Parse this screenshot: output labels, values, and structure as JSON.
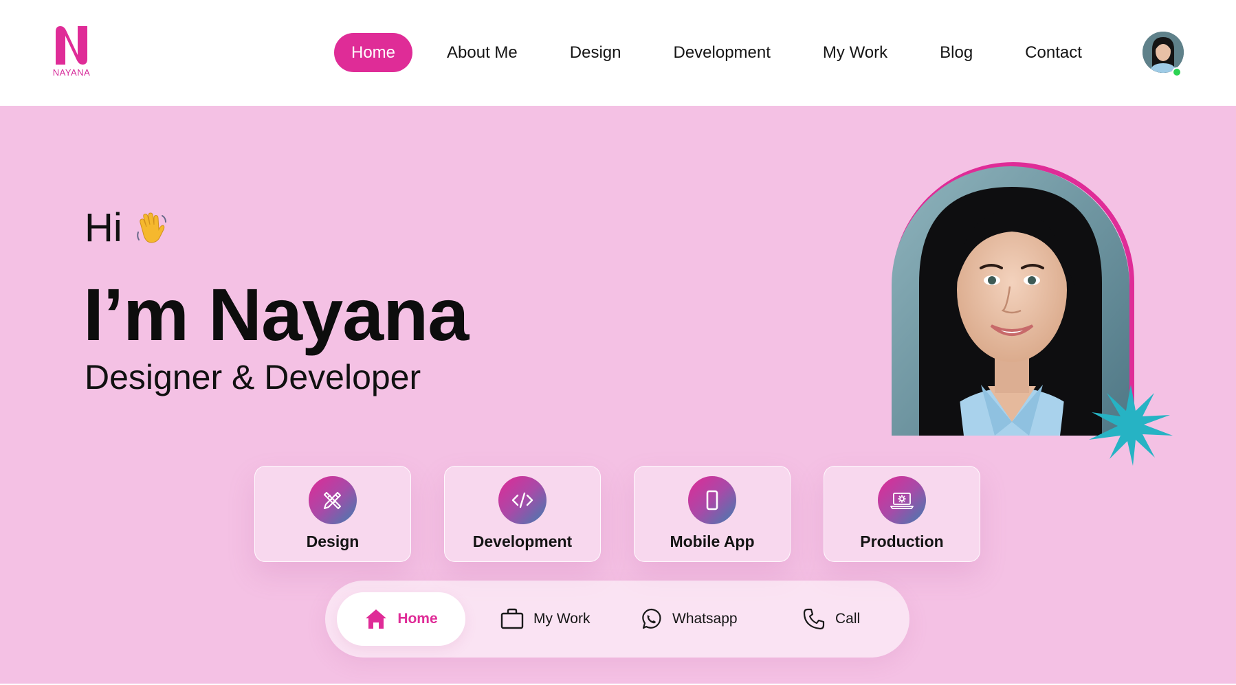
{
  "brand": {
    "logo_text": "NAYANA",
    "accent": "#df2c97"
  },
  "nav": {
    "items": [
      {
        "label": "Home",
        "active": true
      },
      {
        "label": "About Me",
        "active": false
      },
      {
        "label": "Design",
        "active": false
      },
      {
        "label": "Development",
        "active": false
      },
      {
        "label": "My Work",
        "active": false
      },
      {
        "label": "Blog",
        "active": false
      },
      {
        "label": "Contact",
        "active": false
      }
    ],
    "avatar_status": "online"
  },
  "hero": {
    "greeting": "Hi",
    "greeting_icon": "waving-hand-icon",
    "name": "I’m Nayana",
    "role": "Designer & Developer",
    "background": "#f4c1e4"
  },
  "services": [
    {
      "label": "Design",
      "icon": "pencil-ruler-icon"
    },
    {
      "label": "Development",
      "icon": "code-icon"
    },
    {
      "label": "Mobile App",
      "icon": "phone-icon"
    },
    {
      "label": "Production",
      "icon": "laptop-gear-icon"
    }
  ],
  "dock": [
    {
      "label": "Home",
      "icon": "home-icon",
      "active": true
    },
    {
      "label": "My Work",
      "icon": "briefcase-icon",
      "active": false
    },
    {
      "label": "Whatsapp",
      "icon": "whatsapp-icon",
      "active": false
    },
    {
      "label": "Call",
      "icon": "phone-call-icon",
      "active": false
    }
  ]
}
